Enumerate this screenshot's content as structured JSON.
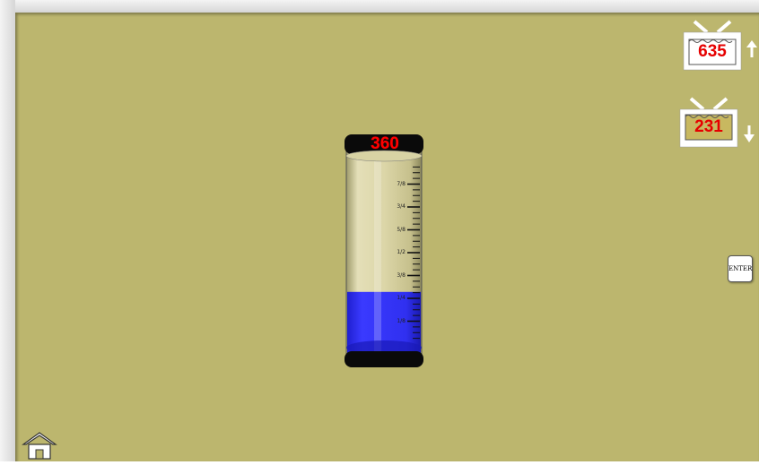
{
  "cylinder": {
    "readout": "360",
    "fill_fraction": 0.3,
    "liquid_color": "#2b2bff",
    "tick_labels": [
      "7/8",
      "3/4",
      "5/8",
      "1/2",
      "3/8",
      "1/4",
      "1/8"
    ]
  },
  "pour_up": {
    "value": "635",
    "icon": "arrow-up-icon"
  },
  "pour_down": {
    "value": "231",
    "icon": "arrow-down-icon"
  },
  "enter_button": {
    "label": "ENTER"
  },
  "home": {
    "icon": "home-icon"
  },
  "colors": {
    "background": "#bcb66e",
    "readout": "#ff0000"
  }
}
